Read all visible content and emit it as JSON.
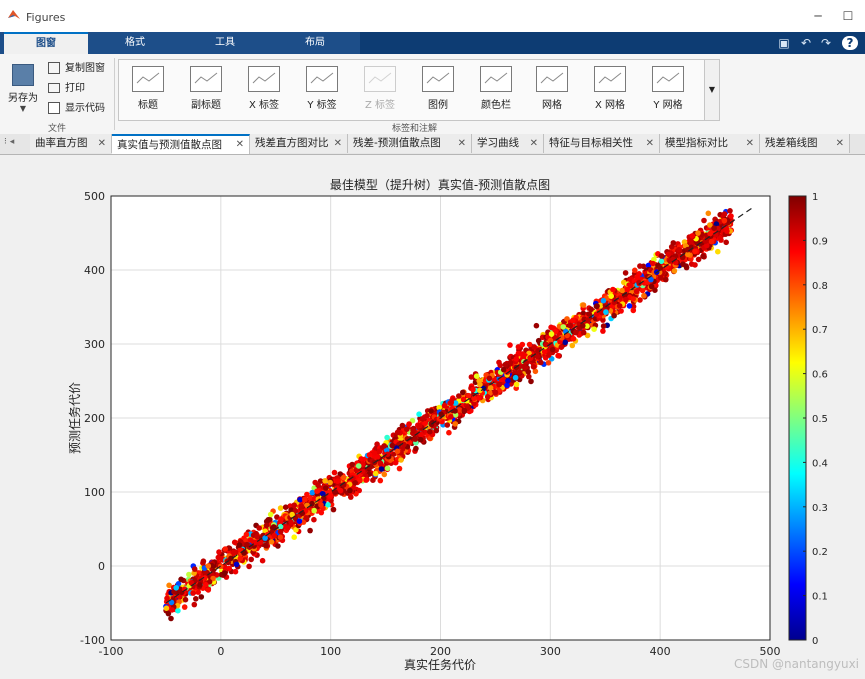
{
  "window": {
    "title": "Figures"
  },
  "ribbon_tabs": [
    "图窗",
    "格式",
    "工具",
    "布局"
  ],
  "file_group": {
    "label": "文件",
    "save_as": "另存为",
    "copy": "复制图窗",
    "print": "打印",
    "show_code": "显示代码"
  },
  "labels_group": {
    "label": "标签和注解",
    "buttons": [
      {
        "label": "标题",
        "icon": "title-icon"
      },
      {
        "label": "副标题",
        "icon": "subtitle-icon"
      },
      {
        "label": "X 标签",
        "icon": "xlabel-icon"
      },
      {
        "label": "Y 标签",
        "icon": "ylabel-icon"
      },
      {
        "label": "Z 标签",
        "icon": "zlabel-icon",
        "disabled": true
      },
      {
        "label": "图例",
        "icon": "legend-icon"
      },
      {
        "label": "颜色栏",
        "icon": "colorbar-icon"
      },
      {
        "label": "网格",
        "icon": "grid-icon"
      },
      {
        "label": "X 网格",
        "icon": "xgrid-icon"
      },
      {
        "label": "Y 网格",
        "icon": "ygrid-icon"
      }
    ]
  },
  "doc_tabs": [
    "曲率直方图",
    "真实值与预测值散点图",
    "残差直方图对比",
    "残差-预测值散点图",
    "学习曲线",
    "特征与目标相关性",
    "模型指标对比",
    "残差箱线图"
  ],
  "active_doc_tab": 1,
  "watermark": "CSDN @nantangyuxi",
  "chart_data": {
    "type": "scatter",
    "title": "最佳模型（提升树）真实值-预测值散点图",
    "xlabel": "真实任务代价",
    "ylabel": "预测任务代价",
    "xlim": [
      -100,
      500
    ],
    "ylim": [
      -100,
      500
    ],
    "xticks": [
      -100,
      0,
      100,
      200,
      300,
      400,
      500
    ],
    "yticks": [
      -100,
      0,
      100,
      200,
      300,
      400,
      500
    ],
    "grid": true,
    "reference_line": {
      "style": "dashed",
      "x": [
        -50,
        485
      ],
      "y": [
        -50,
        485
      ]
    },
    "colorbar": {
      "colormap": "jet",
      "range": [
        0,
        1
      ],
      "ticks": [
        0,
        0.1,
        0.2,
        0.3,
        0.4,
        0.5,
        0.6,
        0.7,
        0.8,
        0.9,
        1
      ],
      "dominant_value": 0.95
    },
    "points": {
      "approx_count": 2500,
      "x_range": [
        -50,
        465
      ],
      "spread_about_diagonal": 18
    }
  }
}
